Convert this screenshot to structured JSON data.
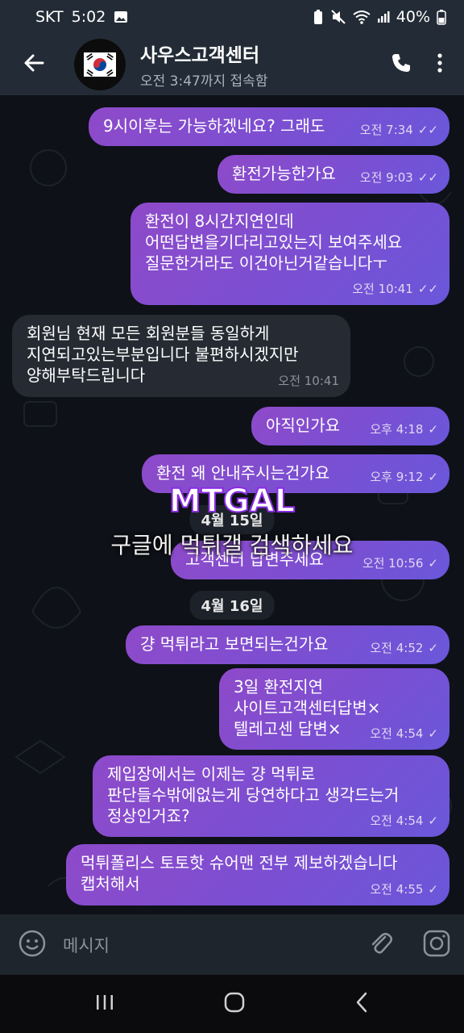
{
  "status_bar": {
    "carrier": "SKT",
    "time": "5:02",
    "battery": "40%"
  },
  "header": {
    "title": "사우스고객센터",
    "subtitle": "오전 3:47까지 접속함"
  },
  "messages": [
    {
      "dir": "out",
      "text": "9시이후는 가능하겠네요? 그래도",
      "time": "오전 7:34"
    },
    {
      "dir": "out",
      "text": "환전가능한가요",
      "time": "오전 9:03"
    },
    {
      "dir": "out",
      "text": "환전이 8시간지연인데\n어떤답변을기다리고있는지 보여주세요\n질문한거라도 이건아닌거같습니다ㅜ",
      "time": "오전 10:41"
    },
    {
      "dir": "in",
      "text": "회원님 현재 모든 회원분들 동일하게\n지연되고있는부분입니다 불편하시겠지만\n양해부탁드립니다",
      "time": "오전 10:41"
    },
    {
      "dir": "out",
      "text": "아직인가요",
      "time": "오후 4:18"
    },
    {
      "dir": "out",
      "text": "환전 왜 안내주시는건가요",
      "time": "오후 9:12"
    },
    {
      "dir": "out",
      "text": "고객센터 답변주세요",
      "time": "오전 10:56"
    },
    {
      "dir": "out",
      "text": "걍 먹튀라고 보면되는건가요",
      "time": "오전 4:52"
    },
    {
      "dir": "out",
      "text": "3일 환전지연\n사이트고객센터답변×\n텔레고센 답변×",
      "time": "오전 4:54"
    },
    {
      "dir": "out",
      "text": "제입장에서는 이제는 걍 먹튀로\n판단들수밖에없는게 당연하다고 생각드는거\n정상인거죠?",
      "time": "오전 4:54"
    },
    {
      "dir": "out",
      "text": "먹튀폴리스 토토핫 슈어맨 전부 제보하겠습니다\n캡처해서",
      "time": "오전 4:55"
    }
  ],
  "dates": {
    "first": "4월 15일",
    "second": "4월 16일"
  },
  "watermark": {
    "logo": "MTGAL",
    "caption": "구글에 먹튀갤 검색하세요"
  },
  "input": {
    "placeholder": "메시지"
  },
  "icons": {
    "back": "back-arrow-icon",
    "call": "phone-icon",
    "menu": "more-vert-icon",
    "emoji": "emoji-icon",
    "attach": "paperclip-icon",
    "camera": "camera-icon"
  },
  "colors": {
    "header": "#232c36",
    "chat_bg": "#0e1118",
    "outgoing": "#8e4ac9",
    "incoming": "#262b33"
  }
}
